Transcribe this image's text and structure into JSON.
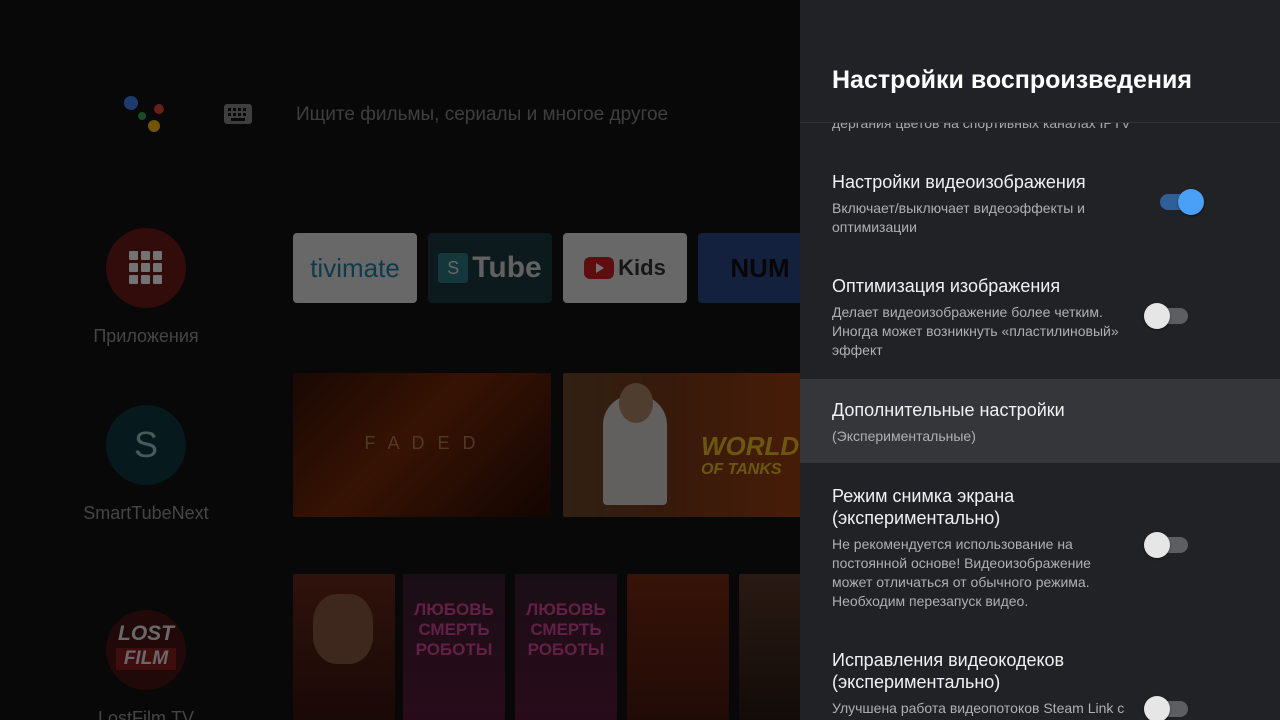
{
  "launcher": {
    "search_placeholder": "Ищите фильмы, сериалы и многое другое",
    "side_apps": [
      {
        "label": "Приложения"
      },
      {
        "label": "SmartTubeNext",
        "glyph": "S"
      },
      {
        "label": "LostFilm.TV",
        "glyph_top": "LOST",
        "glyph_bottom": "FILM"
      }
    ],
    "tiles": [
      {
        "text": "tivimate"
      },
      {
        "text": "Tube",
        "badge": "S"
      },
      {
        "text": "Kids"
      },
      {
        "text": "NUM"
      }
    ],
    "thumbs": [
      {
        "title": "F A D E D"
      },
      {
        "title_top": "WORLD",
        "title_mid": "OF TANKS"
      }
    ],
    "posters": [
      "ЛЮБОВЬ СМЕРТЬ РОБОТЫ",
      "ЛЮБОВЬ СМЕРТЬ РОБОТЫ"
    ],
    "colors": {
      "apps_circle": "#6f1a1a",
      "smarttube_circle": "#0f3940",
      "lostfilm_circle": "#4a1414"
    }
  },
  "panel": {
    "title": "Настройки воспроизведения",
    "cut_description": "дергания цветов на спортивных каналах IPTV",
    "items": [
      {
        "title": "Настройки видеоизображения",
        "description": "Включает/выключает видеоэффекты и оптимизации",
        "toggle": "on"
      },
      {
        "title": "Оптимизация изображения",
        "description": "Делает видеоизображение более четким. Иногда может возникнуть «пластилиновый» эффект",
        "toggle": "off"
      },
      {
        "title": "Дополнительные настройки",
        "description": "(Экспериментальные)",
        "selected": true
      },
      {
        "title": "Режим снимка экрана (экспериментально)",
        "description": "Не рекомендуется использование на постоянной основе! Видеоизображение может отличаться от обычного режима. Необходим перезапуск видео.",
        "toggle": "off"
      },
      {
        "title": "Исправления видеокодеков (экспериментально)",
        "description": "Улучшена работа видеопотоков Steam Link с",
        "toggle": "off"
      }
    ],
    "colors": {
      "background": "#212226",
      "selected": "#35363a",
      "toggle_on": "#4aa0f7"
    }
  }
}
